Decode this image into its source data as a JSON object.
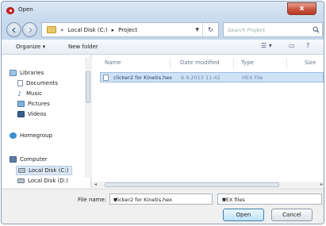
{
  "window": {
    "title": "Open",
    "close_symbol": "x"
  },
  "nav": {
    "breadcrumb_prefix": "«",
    "breadcrumb": [
      "Local Disk (C:)",
      "Project"
    ],
    "separator": "▸",
    "search_placeholder": "Search Project"
  },
  "toolbar": {
    "organize": "Organize ▾",
    "new_folder": "New folder"
  },
  "sidebar": {
    "items": [
      {
        "label": "Libraries",
        "icon": "libraries-icon"
      },
      {
        "label": "Documents",
        "icon": "documents-icon"
      },
      {
        "label": "Music",
        "icon": "music-icon"
      },
      {
        "label": "Pictures",
        "icon": "pictures-icon"
      },
      {
        "label": "Videos",
        "icon": "videos-icon"
      },
      {
        "label": "Homegroup",
        "icon": "homegroup-icon"
      },
      {
        "label": "Computer",
        "icon": "computer-icon"
      },
      {
        "label": "Local Disk (C:)",
        "icon": "drive-icon"
      },
      {
        "label": "Local Disk (D:)",
        "icon": "drive-icon"
      }
    ]
  },
  "columns": [
    "Name",
    "Date modified",
    "Type",
    "Size"
  ],
  "files": [
    {
      "name": "clicker2 for Kinetis.hex",
      "date": "6.9.2013 11:42",
      "type": "HEX File",
      "size": ""
    }
  ],
  "bottom": {
    "file_name_label": "File name:",
    "file_name_value": "clicker2 for Kinetis.hex",
    "file_type": "HEX files",
    "open": "Open",
    "cancel": "Cancel"
  },
  "colors": {
    "accent": "#3c7fb1",
    "close": "#c7503c",
    "selection": "#cfe2f6"
  }
}
